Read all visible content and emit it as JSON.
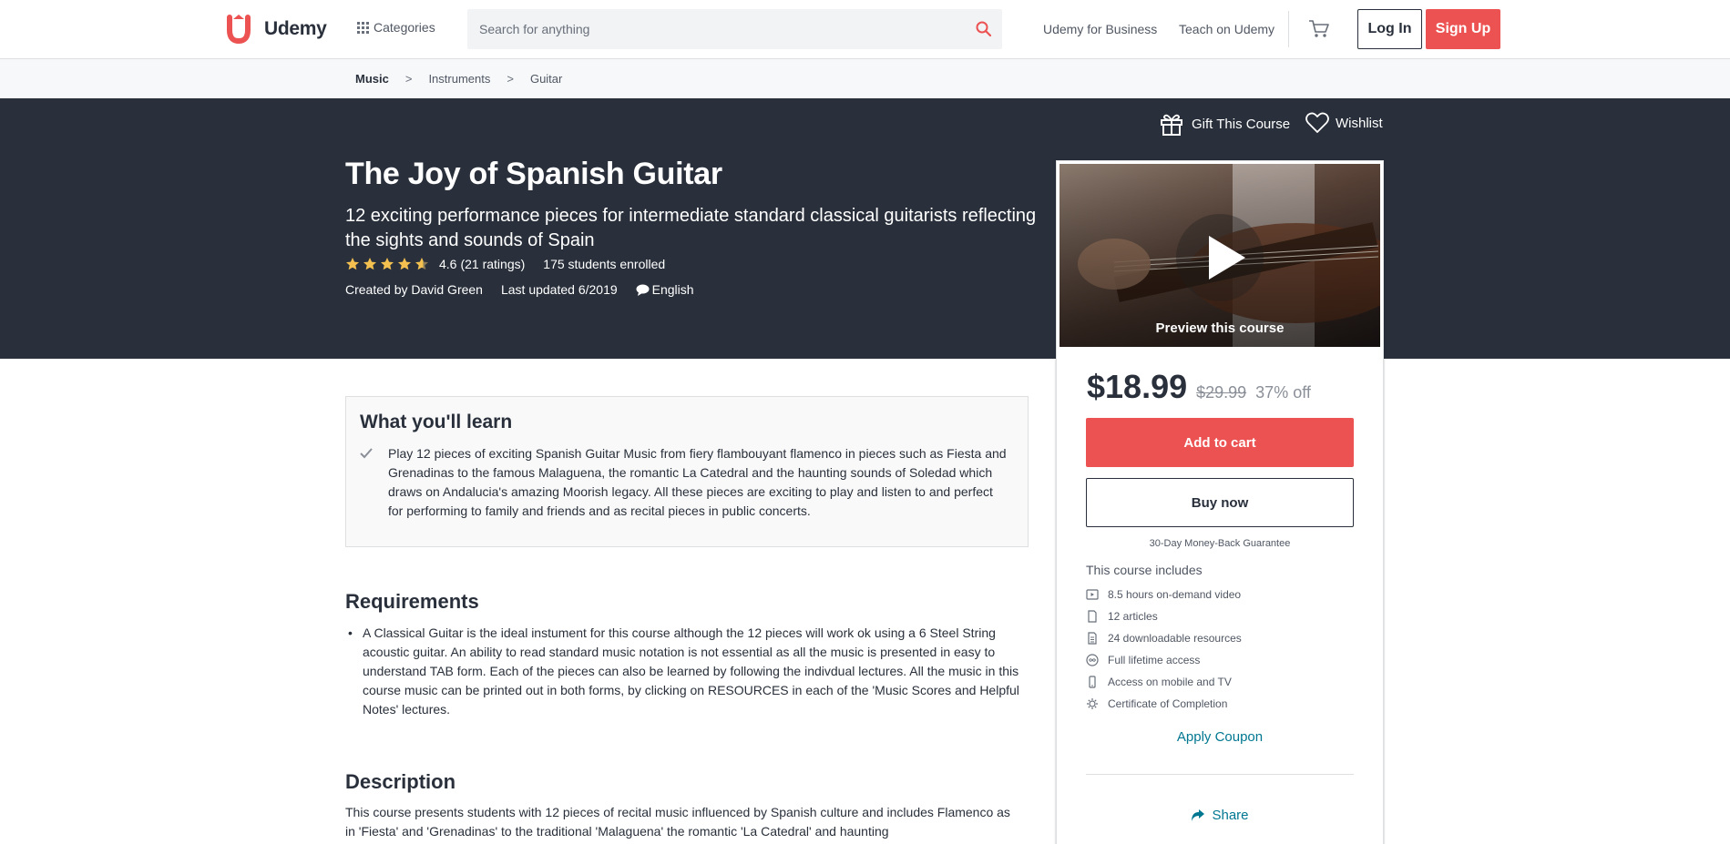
{
  "header": {
    "logo_text": "Udemy",
    "categories_label": "Categories",
    "search_placeholder": "Search for anything",
    "udemy_for_business": "Udemy for Business",
    "teach_on_udemy": "Teach on Udemy",
    "login_label": "Log In",
    "signup_label": "Sign Up"
  },
  "breadcrumb": {
    "items": [
      "Music",
      "Instruments",
      "Guitar"
    ],
    "separator": ">"
  },
  "hero": {
    "gift_label": "Gift This Course",
    "wishlist_label": "Wishlist",
    "title": "The Joy of Spanish Guitar",
    "subtitle": "12 exciting performance pieces for intermediate standard classical guitarists reflecting the sights and sounds of Spain",
    "rating_value": "4.6",
    "rating_count": "(21 ratings)",
    "rating_stars": 4.6,
    "students": "175 students enrolled",
    "created_by": "Created by David Green",
    "last_updated": "Last updated 6/2019",
    "language": "English"
  },
  "sidebar": {
    "preview_label": "Preview this course",
    "price": "$18.99",
    "original_price": "$29.99",
    "discount": "37% off",
    "add_to_cart": "Add to cart",
    "buy_now": "Buy now",
    "guarantee": "30-Day Money-Back Guarantee",
    "includes_title": "This course includes",
    "includes": [
      {
        "icon": "video-icon",
        "label": "8.5 hours on-demand video"
      },
      {
        "icon": "article-icon",
        "label": "12 articles"
      },
      {
        "icon": "file-icon",
        "label": "24 downloadable resources"
      },
      {
        "icon": "infinity-icon",
        "label": "Full lifetime access"
      },
      {
        "icon": "mobile-icon",
        "label": "Access on mobile and TV"
      },
      {
        "icon": "certificate-icon",
        "label": "Certificate of Completion"
      }
    ],
    "apply_coupon": "Apply Coupon",
    "share": "Share"
  },
  "learn": {
    "title": "What you'll learn",
    "items": [
      "Play 12 pieces of exciting Spanish Guitar Music from fiery flambouyant flamenco in pieces such as Fiesta and Grenadinas to the famous Malaguena, the romantic La Catedral and the haunting sounds of Soledad which draws on Andalucia's amazing Moorish legacy. All these pieces are exciting to play and listen to and perfect for performing to family and friends and as recital pieces in public concerts."
    ]
  },
  "requirements": {
    "title": "Requirements",
    "items": [
      "A Classical Guitar is the ideal instument for this course although the 12 pieces will work ok using a 6 Steel String acoustic guitar. An ability to read standard music notation is not essential as all the music is presented in easy to understand TAB form. Each of the pieces can also be learned by following the indivdual lectures. All the music in this course music can be printed out in both forms, by clicking on RESOURCES in each of the 'Music Scores and Helpful Notes' lectures."
    ]
  },
  "description": {
    "title": "Description",
    "text": "This course presents students with 12 pieces of recital music influenced by Spanish culture and includes Flamenco as in 'Fiesta' and 'Grenadinas' to the traditional 'Malaguena' the romantic 'La Catedral' and haunting"
  },
  "colors": {
    "brand_red": "#ec5252",
    "hero_bg": "#29303b",
    "link_teal": "#007791",
    "star_gold": "#f4c150"
  }
}
